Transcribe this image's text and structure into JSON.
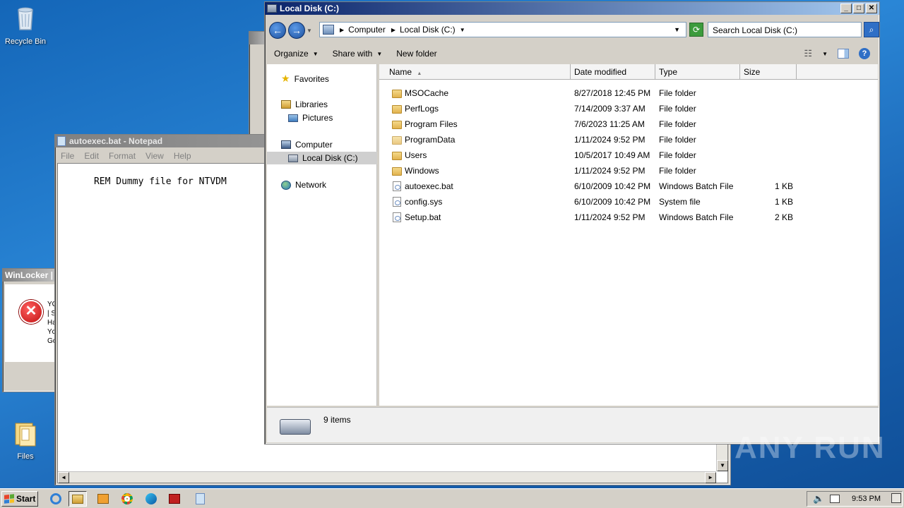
{
  "desktop": {
    "icons": [
      {
        "label": "Recycle Bin"
      },
      {
        "label": "Files"
      }
    ],
    "watermark": "ANY RUN"
  },
  "winlocker": {
    "title": "WinLocker |",
    "lines": [
      "YC",
      "| S",
      "Ha",
      "Yc",
      "Gc"
    ]
  },
  "notepad": {
    "title": "autoexec.bat - Notepad",
    "menu": [
      "File",
      "Edit",
      "Format",
      "View",
      "Help"
    ],
    "content": "REM Dummy file for NTVDM"
  },
  "explorer": {
    "title": "Local Disk (C:)",
    "breadcrumb": [
      "Computer",
      "Local Disk (C:)"
    ],
    "search_placeholder": "Search Local Disk (C:)",
    "commands": {
      "organize": "Organize",
      "share": "Share with",
      "new_folder": "New folder"
    },
    "nav": {
      "favorites": "Favorites",
      "libraries": "Libraries",
      "pictures": "Pictures",
      "computer": "Computer",
      "local_disk": "Local Disk (C:)",
      "network": "Network"
    },
    "columns": {
      "name": "Name",
      "date": "Date modified",
      "type": "Type",
      "size": "Size"
    },
    "files": [
      {
        "name": "MSOCache",
        "date": "8/27/2018 12:45 PM",
        "type": "File folder",
        "size": "",
        "kind": "folder-locked"
      },
      {
        "name": "PerfLogs",
        "date": "7/14/2009 3:37 AM",
        "type": "File folder",
        "size": "",
        "kind": "folder"
      },
      {
        "name": "Program Files",
        "date": "7/6/2023 11:25 AM",
        "type": "File folder",
        "size": "",
        "kind": "folder"
      },
      {
        "name": "ProgramData",
        "date": "1/11/2024 9:52 PM",
        "type": "File folder",
        "size": "",
        "kind": "folder"
      },
      {
        "name": "Users",
        "date": "10/5/2017 10:49 AM",
        "type": "File folder",
        "size": "",
        "kind": "folder"
      },
      {
        "name": "Windows",
        "date": "1/11/2024 9:52 PM",
        "type": "File folder",
        "size": "",
        "kind": "folder"
      },
      {
        "name": "autoexec.bat",
        "date": "6/10/2009 10:42 PM",
        "type": "Windows Batch File",
        "size": "1 KB",
        "kind": "file"
      },
      {
        "name": "config.sys",
        "date": "6/10/2009 10:42 PM",
        "type": "System file",
        "size": "1 KB",
        "kind": "file"
      },
      {
        "name": "Setup.bat",
        "date": "1/11/2024 9:52 PM",
        "type": "Windows Batch File",
        "size": "2 KB",
        "kind": "file"
      }
    ],
    "status": "9 items"
  },
  "taskbar": {
    "start_label": "Start",
    "clock": "9:53 PM"
  }
}
